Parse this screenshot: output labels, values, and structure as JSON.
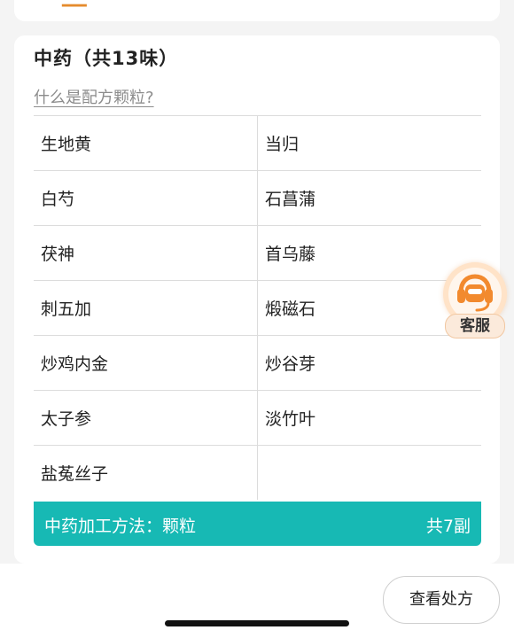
{
  "section": {
    "title": "中药（共13味）",
    "help_link": "什么是配方颗粒?"
  },
  "herbs": [
    [
      "生地黄",
      "当归"
    ],
    [
      "白芍",
      "石菖蒲"
    ],
    [
      "茯神",
      "首乌藤"
    ],
    [
      "刺五加",
      "煅磁石"
    ],
    [
      "炒鸡内金",
      "炒谷芽"
    ],
    [
      "太子参",
      "淡竹叶"
    ],
    [
      "盐菟丝子",
      ""
    ]
  ],
  "processing": {
    "label": "中药加工方法：颗粒",
    "count": "共7副"
  },
  "service": {
    "label": "客服",
    "icon": "headset-icon"
  },
  "footer": {
    "view_prescription": "查看处方"
  },
  "colors": {
    "accent_teal": "#17b9b4",
    "service_orange": "#f28a2e",
    "background": "#f4f4f4"
  }
}
